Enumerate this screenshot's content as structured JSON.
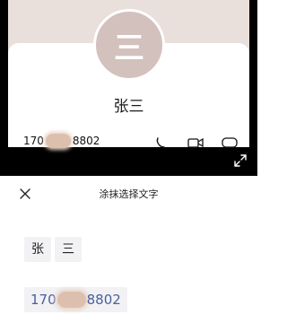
{
  "preview": {
    "avatar_text": "三",
    "name": "张三",
    "phone_prefix": "170",
    "phone_suffix": "8802"
  },
  "sheet": {
    "title": "涂抹选择文字",
    "name_chars": [
      "张",
      "三"
    ],
    "phone_prefix": "170",
    "phone_suffix": "8802"
  },
  "colors": {
    "avatar_bg": "#d3c1bd",
    "banner_bg": "#e9dfdb",
    "phone_link": "#4a5f9c",
    "chip_bg": "#f2f2f4"
  },
  "icons": [
    "phone-icon",
    "video-icon",
    "message-icon",
    "expand-icon",
    "close-icon"
  ]
}
